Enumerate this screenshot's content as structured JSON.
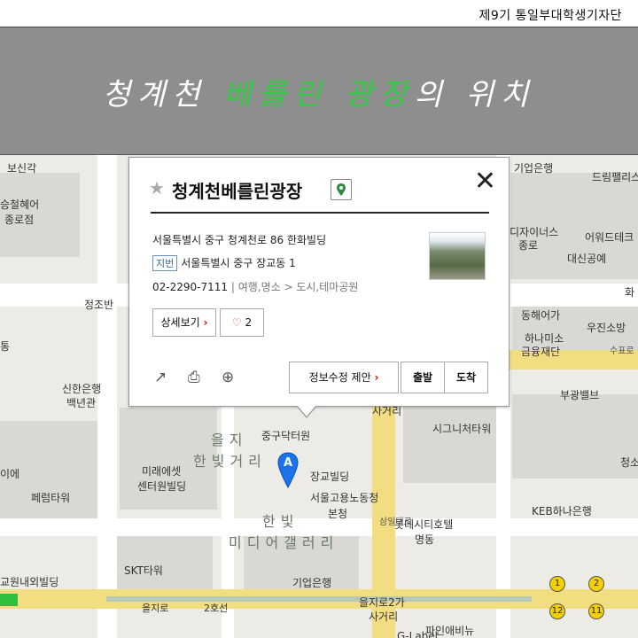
{
  "header": {
    "credit": "제9기 통일부대학생기자단"
  },
  "banner": {
    "title_pre": "청계천 ",
    "title_highlight": "베를린 광장",
    "title_post": "의 위치"
  },
  "popup": {
    "name": "청계천베를린광장",
    "address": "서울특별시 중구 청계천로 86 한화빌딩",
    "jibun_tag": "지번",
    "jibun_address": "서울특별시 중구 장교동 1",
    "phone": "02-2290-7111",
    "category": "여행,명소 > 도시,테마공원",
    "detail_label": "상세보기",
    "like_count": "2",
    "suggest_label": "정보수정 제안",
    "depart_label": "출발",
    "arrive_label": "도착",
    "close_symbol": "✕"
  },
  "map": {
    "labels": [
      "보신각",
      "승철혜어",
      "종로점",
      "정조반",
      "통",
      "신한은행",
      "백년관",
      "이에",
      "미래에셋",
      "센터원빌딩",
      "페럼타워",
      "SKT타워",
      "교원내외빌딩",
      "을지로",
      "2호선",
      "중구닥터원",
      "장교빌딩",
      "서울고용노동청",
      "본청",
      "기업은행",
      "을지로2가",
      "사거리",
      "파인애비뉴",
      "시그니처타워",
      "롯데시티호텔",
      "명동",
      "KEB하나은행",
      "기업은행",
      "드림팰리스",
      "디자이너스",
      "종로",
      "어워드테크",
      "대신공예",
      "동해어가",
      "하나미소",
      "금융재단",
      "우진소방",
      "부광밸브",
      "화",
      "청소",
      "수표로",
      "사거리",
      "삼일대로",
      "G-Label"
    ],
    "area_labels": [
      "을지",
      "한빛거리",
      "한빛",
      "미디어갤러리"
    ],
    "marker_letter": "A",
    "subway_exits": [
      "1",
      "2",
      "12",
      "11"
    ]
  },
  "colors": {
    "accent_green": "#33cc44",
    "banner_bg": "#8e8e8e",
    "marker_blue": "#1a73e8"
  }
}
